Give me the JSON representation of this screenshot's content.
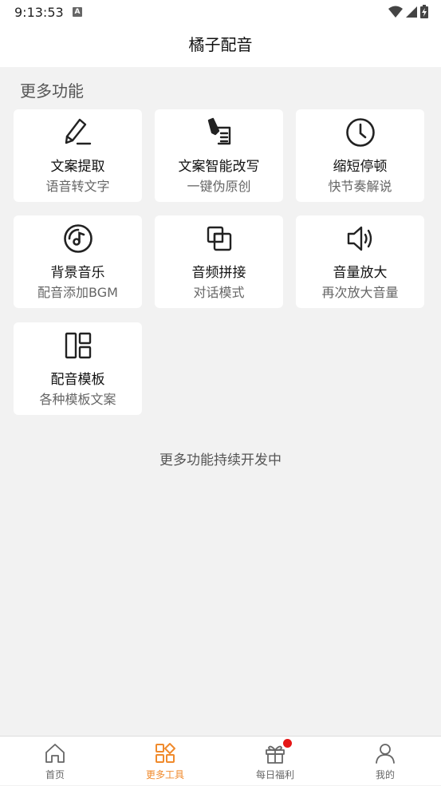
{
  "status": {
    "time": "9:13:53",
    "notif_letter": "A"
  },
  "header": {
    "title": "橘子配音"
  },
  "section": {
    "title": "更多功能"
  },
  "features": [
    {
      "name": "文案提取",
      "desc": "语音转文字",
      "icon": "pen-icon"
    },
    {
      "name": "文案智能改写",
      "desc": "一键伪原创",
      "icon": "pen-document-icon"
    },
    {
      "name": "缩短停顿",
      "desc": "快节奏解说",
      "icon": "clock-icon"
    },
    {
      "name": "背景音乐",
      "desc": "配音添加BGM",
      "icon": "music-disc-icon"
    },
    {
      "name": "音频拼接",
      "desc": "对话模式",
      "icon": "overlap-squares-icon"
    },
    {
      "name": "音量放大",
      "desc": "再次放大音量",
      "icon": "speaker-icon"
    },
    {
      "name": "配音模板",
      "desc": "各种模板文案",
      "icon": "layout-template-icon"
    }
  ],
  "footer_note": "更多功能持续开发中",
  "tabs": [
    {
      "label": "首页",
      "icon": "home-icon"
    },
    {
      "label": "更多工具",
      "icon": "grid-diamond-icon",
      "active": true
    },
    {
      "label": "每日福利",
      "icon": "gift-icon"
    },
    {
      "label": "我的",
      "icon": "person-icon"
    }
  ],
  "colors": {
    "accent": "#f08a2c",
    "badge": "#e51616",
    "background": "#f2f2f2"
  }
}
